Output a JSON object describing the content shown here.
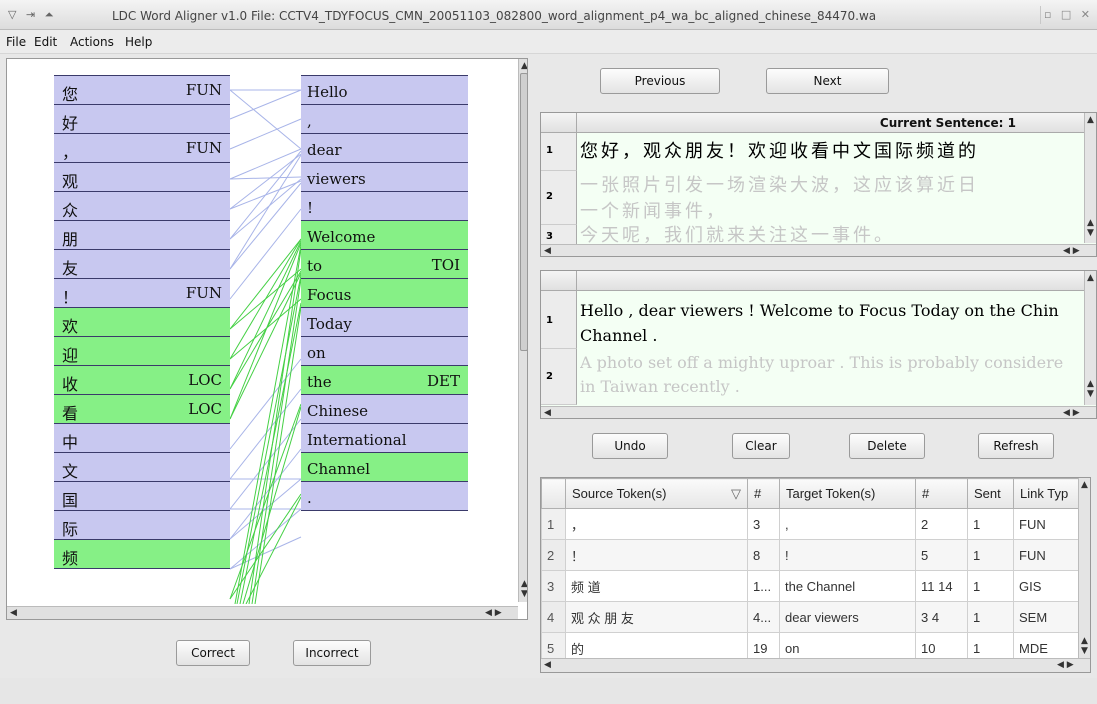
{
  "window": {
    "title": "LDC Word Aligner v1.0  File: CCTV4_TDYFOCUS_CMN_20051103_082800_word_alignment_p4_wa_bc_aligned_chinese_84470.wa"
  },
  "menu": {
    "items": [
      {
        "label": "File",
        "mnemonic": "F"
      },
      {
        "label": "Edit",
        "mnemonic": "E"
      },
      {
        "label": "Actions",
        "mnemonic": "A"
      },
      {
        "label": "Help",
        "mnemonic": "H"
      }
    ]
  },
  "source_tokens": [
    {
      "text": "您",
      "tag": "FUN",
      "color": "blue"
    },
    {
      "text": "好",
      "tag": "",
      "color": "blue"
    },
    {
      "text": "，",
      "tag": "FUN",
      "color": "blue"
    },
    {
      "text": "观",
      "tag": "",
      "color": "blue"
    },
    {
      "text": "众",
      "tag": "",
      "color": "blue"
    },
    {
      "text": "朋",
      "tag": "",
      "color": "blue"
    },
    {
      "text": "友",
      "tag": "",
      "color": "blue"
    },
    {
      "text": "！",
      "tag": "FUN",
      "color": "blue"
    },
    {
      "text": "欢",
      "tag": "",
      "color": "green"
    },
    {
      "text": "迎",
      "tag": "",
      "color": "green"
    },
    {
      "text": "收",
      "tag": "LOC",
      "color": "green"
    },
    {
      "text": "看",
      "tag": "LOC",
      "color": "green"
    },
    {
      "text": "中",
      "tag": "",
      "color": "blue"
    },
    {
      "text": "文",
      "tag": "",
      "color": "blue"
    },
    {
      "text": "国",
      "tag": "",
      "color": "blue"
    },
    {
      "text": "际",
      "tag": "",
      "color": "blue"
    },
    {
      "text": "频",
      "tag": "",
      "color": "green"
    }
  ],
  "target_tokens": [
    {
      "text": "Hello",
      "tag": "",
      "color": "blue"
    },
    {
      "text": ",",
      "tag": "",
      "color": "blue"
    },
    {
      "text": "dear",
      "tag": "",
      "color": "blue"
    },
    {
      "text": "viewers",
      "tag": "",
      "color": "blue"
    },
    {
      "text": "!",
      "tag": "",
      "color": "blue"
    },
    {
      "text": "Welcome",
      "tag": "",
      "color": "green"
    },
    {
      "text": "to",
      "tag": "TOI",
      "color": "green"
    },
    {
      "text": "Focus",
      "tag": "",
      "color": "green"
    },
    {
      "text": "Today",
      "tag": "",
      "color": "blue"
    },
    {
      "text": "on",
      "tag": "",
      "color": "blue"
    },
    {
      "text": "the",
      "tag": "DET",
      "color": "green"
    },
    {
      "text": "Chinese",
      "tag": "",
      "color": "blue"
    },
    {
      "text": "International",
      "tag": "",
      "color": "blue"
    },
    {
      "text": "Channel",
      "tag": "",
      "color": "green"
    },
    {
      "text": ".",
      "tag": "",
      "color": "blue"
    }
  ],
  "buttons": {
    "previous": "Previous",
    "next": "Next",
    "correct": "Correct",
    "incorrect": "Incorrect",
    "undo": "Undo",
    "clear": "Clear",
    "delete": "Delete",
    "refresh": "Refresh"
  },
  "source_panel": {
    "header": "Current Sentence: 1",
    "rows": [
      {
        "num": "1",
        "text": "您好，观众朋友！欢迎收看中文国际频道的",
        "current": true
      },
      {
        "num": "2",
        "text": "一张照片引发一场渲染大波，这应该算近日",
        "text2": "一个新闻事件，",
        "current": false
      },
      {
        "num": "3",
        "text": "今天呢，我们就来关注这一事件。",
        "current": false
      }
    ]
  },
  "target_panel": {
    "rows": [
      {
        "num": "1",
        "text": "Hello , dear viewers ! Welcome to Focus Today on the Chin",
        "text2": "Channel .",
        "current": true
      },
      {
        "num": "2",
        "text": "A photo set off a mighty uproar . This is probably considere",
        "text2": "in Taiwan recently .",
        "current": false
      }
    ]
  },
  "links_table": {
    "columns": [
      "Source Token(s)",
      "#",
      "Target Token(s)",
      "#",
      "Sent",
      "Link Typ"
    ],
    "rows": [
      {
        "n": "1",
        "src": "，",
        "snum": "3",
        "tgt": ",",
        "tnum": "2",
        "sent": "1",
        "type": "FUN"
      },
      {
        "n": "2",
        "src": "！",
        "snum": "8",
        "tgt": "!",
        "tnum": "5",
        "sent": "1",
        "type": "FUN"
      },
      {
        "n": "3",
        "src": "频 道",
        "snum": "1...",
        "tgt": "the Channel",
        "tnum": "11 14",
        "sent": "1",
        "type": "GIS"
      },
      {
        "n": "4",
        "src": "观 众 朋 友",
        "snum": "4...",
        "tgt": "dear viewers",
        "tnum": "3 4",
        "sent": "1",
        "type": "SEM"
      },
      {
        "n": "5",
        "src": "的",
        "snum": "19",
        "tgt": "on",
        "tnum": "10",
        "sent": "1",
        "type": "MDE"
      }
    ]
  },
  "colors": {
    "blue_cell": "#c8c8f0",
    "green_cell": "#86f086",
    "blue_link": "#a8b4e8",
    "green_link": "#44d044"
  }
}
